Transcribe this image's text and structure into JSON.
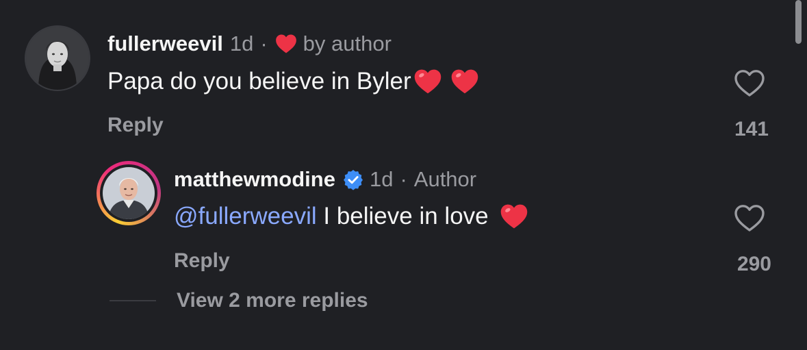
{
  "comments": [
    {
      "username": "fullerweevil",
      "time": "1d",
      "separator": "·",
      "liked_by": "by author",
      "text": "Papa do you believe in Byler",
      "reply_label": "Reply",
      "likes": "141"
    },
    {
      "username": "matthewmodine",
      "time": "1d",
      "separator": "·",
      "role": "Author",
      "mention": "@fullerweevil",
      "text": " I believe in love ",
      "reply_label": "Reply",
      "likes": "290"
    }
  ],
  "view_more_replies": "View 2 more replies",
  "colors": {
    "background": "#1f2024",
    "muted": "#9a9ba0",
    "mention": "#8aa9ff",
    "heart": "#ed3346",
    "verified": "#3d8ef7"
  }
}
